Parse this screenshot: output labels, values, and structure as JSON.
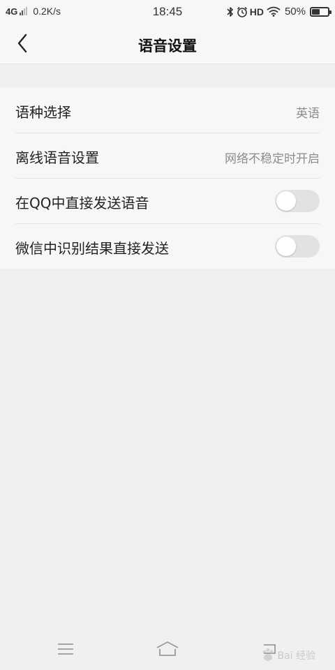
{
  "status_bar": {
    "network": "4G",
    "speed": "0.2K/s",
    "time": "18:45",
    "hd": "HD",
    "battery_percent": "50%",
    "battery_level": 0.5,
    "icons": [
      "signal-icon",
      "bluetooth-icon",
      "alarm-icon",
      "wifi-icon",
      "battery-icon"
    ]
  },
  "header": {
    "title": "语音设置",
    "back_icon": "chevron-left-icon"
  },
  "settings": {
    "items": [
      {
        "label": "语种选择",
        "value": "英语"
      },
      {
        "label": "离线语音设置",
        "value": "网络不稳定时开启"
      },
      {
        "label": "在QQ中直接发送语音",
        "toggle": false
      },
      {
        "label": "微信中识别结果直接发送",
        "toggle": false
      }
    ]
  },
  "bottom_nav": {
    "icons": [
      "menu-icon",
      "home-icon",
      "back-nav-icon"
    ]
  },
  "watermark": {
    "text": "Bai 经验"
  },
  "colors": {
    "background": "#f0f0f0",
    "surface": "#f7f7f7",
    "toggle_off": "#e2e2e2",
    "secondary_text": "#8c8c8c"
  }
}
